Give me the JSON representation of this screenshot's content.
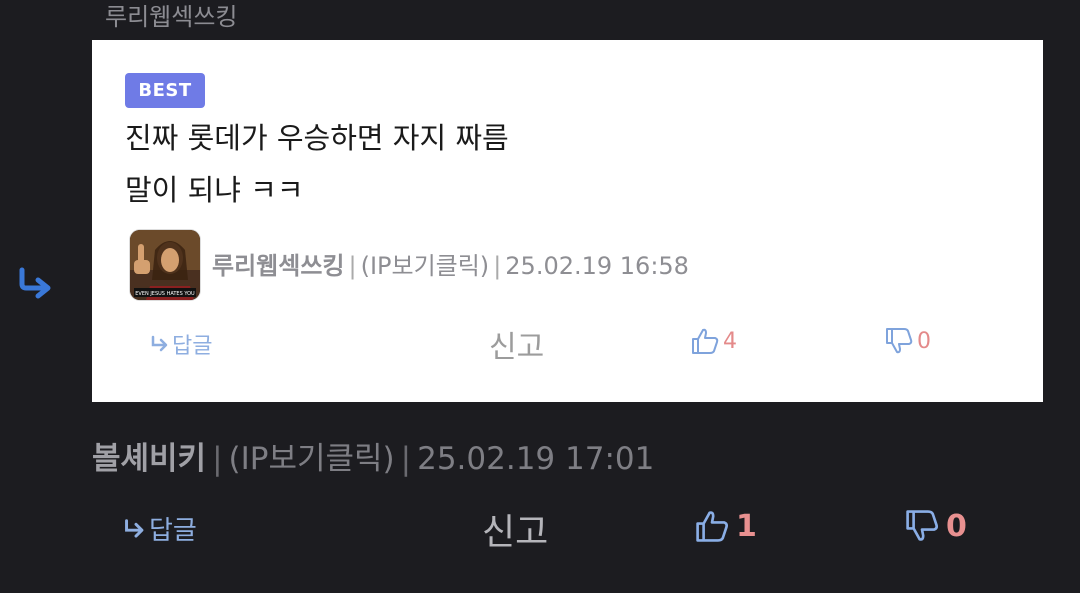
{
  "top_comment_author": "루리웹섹쓰킹",
  "best_comment": {
    "badge": "BEST",
    "lines": [
      "진짜 롯데가 우승하면 자지 짜름",
      "말이 되냐 ㅋㅋ"
    ],
    "author": "루리웹섹쓰킹",
    "ip_label": "(IP보기클릭)",
    "timestamp": "25.02.19 16:58",
    "reply_label": "답글",
    "report_label": "신고",
    "likes": "4",
    "dislikes": "0",
    "avatar_caption": "EVEN JESUS HATES YOU"
  },
  "reply_comment": {
    "author": "볼셰비키",
    "ip_label": "(IP보기클릭)",
    "timestamp": "25.02.19 17:01",
    "reply_label": "답글",
    "report_label": "신고",
    "likes": "1",
    "dislikes": "0"
  },
  "colors": {
    "background": "#1c1c20",
    "badge": "#6f7be6",
    "reply_blue": "#8eaee0",
    "count_red": "#e48a8a",
    "arrow_blue": "#3a78d8"
  },
  "icons": {
    "reply_indicator": "reply-arrow-icon",
    "like": "thumbs-up-icon",
    "dislike": "thumbs-down-icon"
  }
}
